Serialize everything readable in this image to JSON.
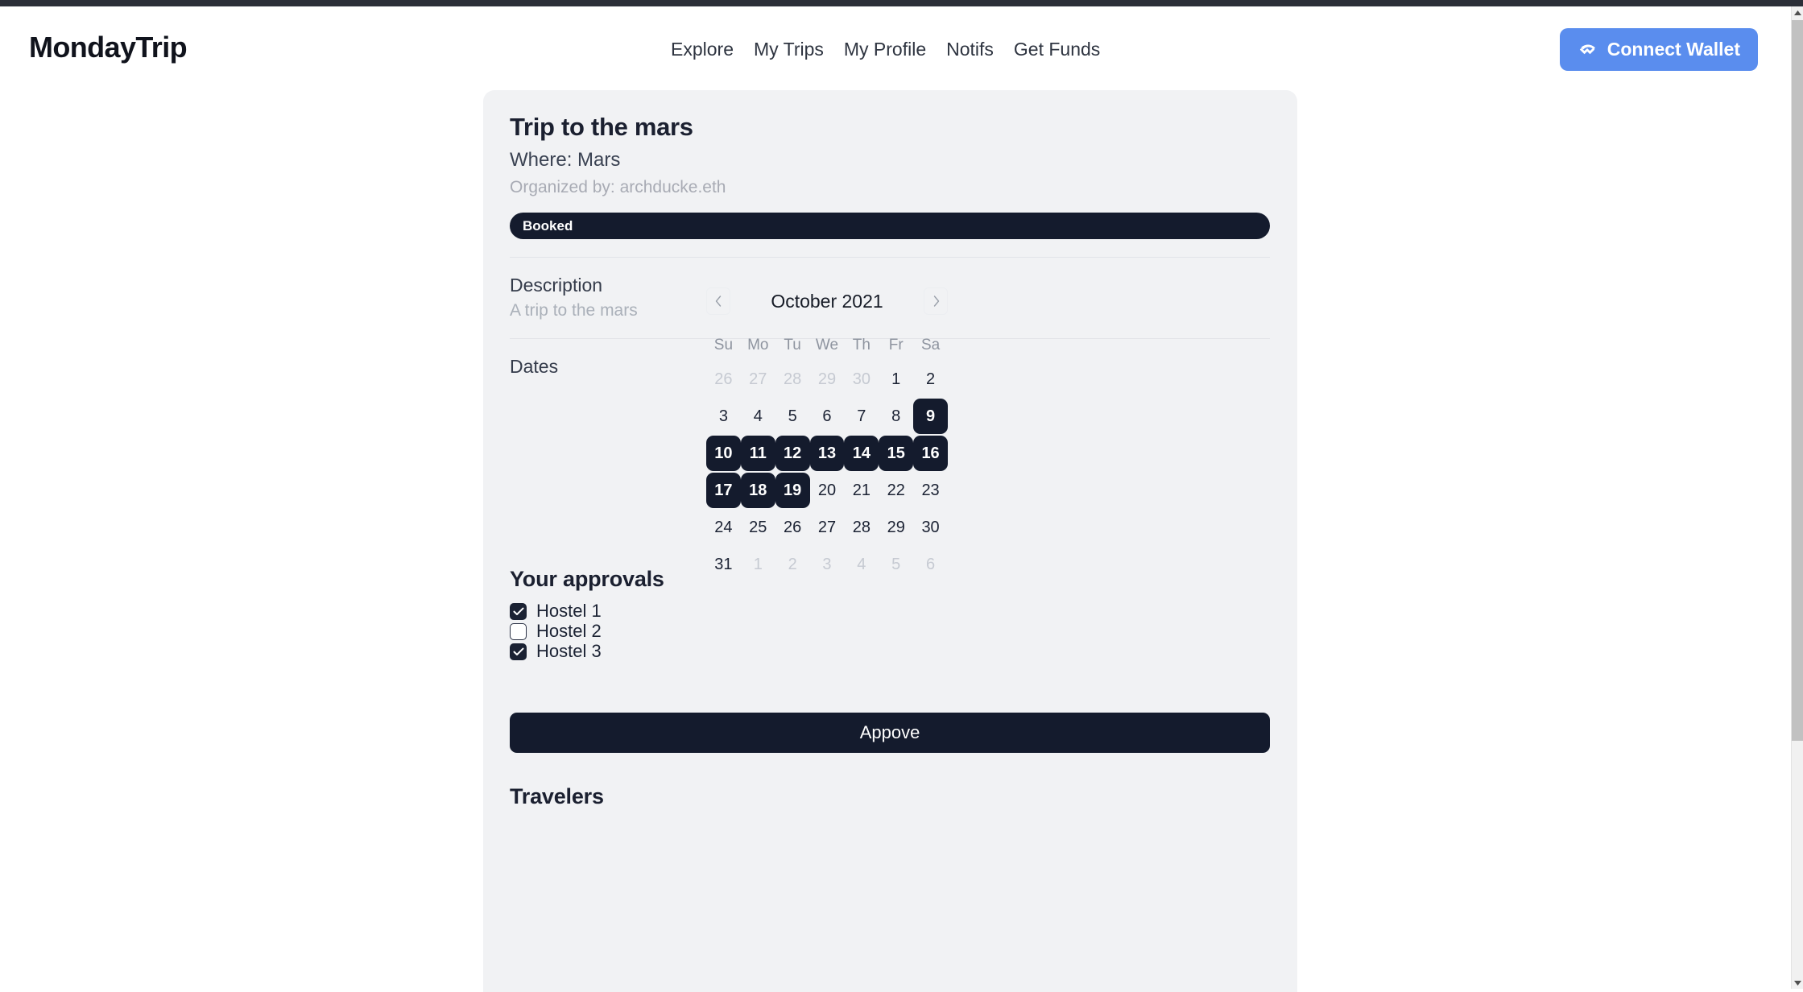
{
  "colors": {
    "accent_blue": "#5a8dee",
    "dark_navy": "#141b2d",
    "card_bg": "#f1f2f4",
    "page_bg": "#ffffff",
    "muted_text": "#a8abb4"
  },
  "header": {
    "logo": "MondayTrip",
    "nav": [
      {
        "label": "Explore",
        "name": "nav-explore"
      },
      {
        "label": "My Trips",
        "name": "nav-my-trips"
      },
      {
        "label": "My Profile",
        "name": "nav-my-profile"
      },
      {
        "label": "Notifs",
        "name": "nav-notifs"
      },
      {
        "label": "Get Funds",
        "name": "nav-get-funds"
      }
    ],
    "connect_wallet_label": "Connect Wallet",
    "wallet_icon": "walletconnect-icon"
  },
  "trip": {
    "title": "Trip to the mars",
    "where": "Where: Mars",
    "organizer": "Organized by: archducke.eth",
    "status": "Booked",
    "description_label": "Description",
    "description_value": "A trip to the mars",
    "dates_label": "Dates"
  },
  "calendar": {
    "month_label": "October 2021",
    "prev_icon": "chevron-left-icon",
    "next_icon": "chevron-right-icon",
    "weekdays": [
      "Su",
      "Mo",
      "Tu",
      "We",
      "Th",
      "Fr",
      "Sa"
    ],
    "weeks": [
      [
        {
          "day": "26",
          "muted": true,
          "selected": false
        },
        {
          "day": "27",
          "muted": true,
          "selected": false
        },
        {
          "day": "28",
          "muted": true,
          "selected": false
        },
        {
          "day": "29",
          "muted": true,
          "selected": false
        },
        {
          "day": "30",
          "muted": true,
          "selected": false
        },
        {
          "day": "1",
          "muted": false,
          "selected": false
        },
        {
          "day": "2",
          "muted": false,
          "selected": false
        }
      ],
      [
        {
          "day": "3",
          "muted": false,
          "selected": false
        },
        {
          "day": "4",
          "muted": false,
          "selected": false
        },
        {
          "day": "5",
          "muted": false,
          "selected": false
        },
        {
          "day": "6",
          "muted": false,
          "selected": false
        },
        {
          "day": "7",
          "muted": false,
          "selected": false
        },
        {
          "day": "8",
          "muted": false,
          "selected": false
        },
        {
          "day": "9",
          "muted": false,
          "selected": true
        }
      ],
      [
        {
          "day": "10",
          "muted": false,
          "selected": true
        },
        {
          "day": "11",
          "muted": false,
          "selected": true
        },
        {
          "day": "12",
          "muted": false,
          "selected": true
        },
        {
          "day": "13",
          "muted": false,
          "selected": true
        },
        {
          "day": "14",
          "muted": false,
          "selected": true
        },
        {
          "day": "15",
          "muted": false,
          "selected": true
        },
        {
          "day": "16",
          "muted": false,
          "selected": true
        }
      ],
      [
        {
          "day": "17",
          "muted": false,
          "selected": true
        },
        {
          "day": "18",
          "muted": false,
          "selected": true
        },
        {
          "day": "19",
          "muted": false,
          "selected": true
        },
        {
          "day": "20",
          "muted": false,
          "selected": false
        },
        {
          "day": "21",
          "muted": false,
          "selected": false
        },
        {
          "day": "22",
          "muted": false,
          "selected": false
        },
        {
          "day": "23",
          "muted": false,
          "selected": false
        }
      ],
      [
        {
          "day": "24",
          "muted": false,
          "selected": false
        },
        {
          "day": "25",
          "muted": false,
          "selected": false
        },
        {
          "day": "26",
          "muted": false,
          "selected": false
        },
        {
          "day": "27",
          "muted": false,
          "selected": false
        },
        {
          "day": "28",
          "muted": false,
          "selected": false
        },
        {
          "day": "29",
          "muted": false,
          "selected": false
        },
        {
          "day": "30",
          "muted": false,
          "selected": false
        }
      ],
      [
        {
          "day": "31",
          "muted": false,
          "selected": false
        },
        {
          "day": "1",
          "muted": true,
          "selected": false
        },
        {
          "day": "2",
          "muted": true,
          "selected": false
        },
        {
          "day": "3",
          "muted": true,
          "selected": false
        },
        {
          "day": "4",
          "muted": true,
          "selected": false
        },
        {
          "day": "5",
          "muted": true,
          "selected": false
        },
        {
          "day": "6",
          "muted": true,
          "selected": false
        }
      ]
    ]
  },
  "approvals": {
    "title": "Your approvals",
    "items": [
      {
        "label": "Hostel 1",
        "checked": true
      },
      {
        "label": "Hostel 2",
        "checked": false
      },
      {
        "label": "Hostel 3",
        "checked": true
      }
    ],
    "approve_button_label": "Appove"
  },
  "travelers": {
    "title": "Travelers"
  },
  "scrollbar": {
    "up_icon": "scroll-up-arrow-icon",
    "down_icon": "scroll-down-arrow-icon"
  }
}
